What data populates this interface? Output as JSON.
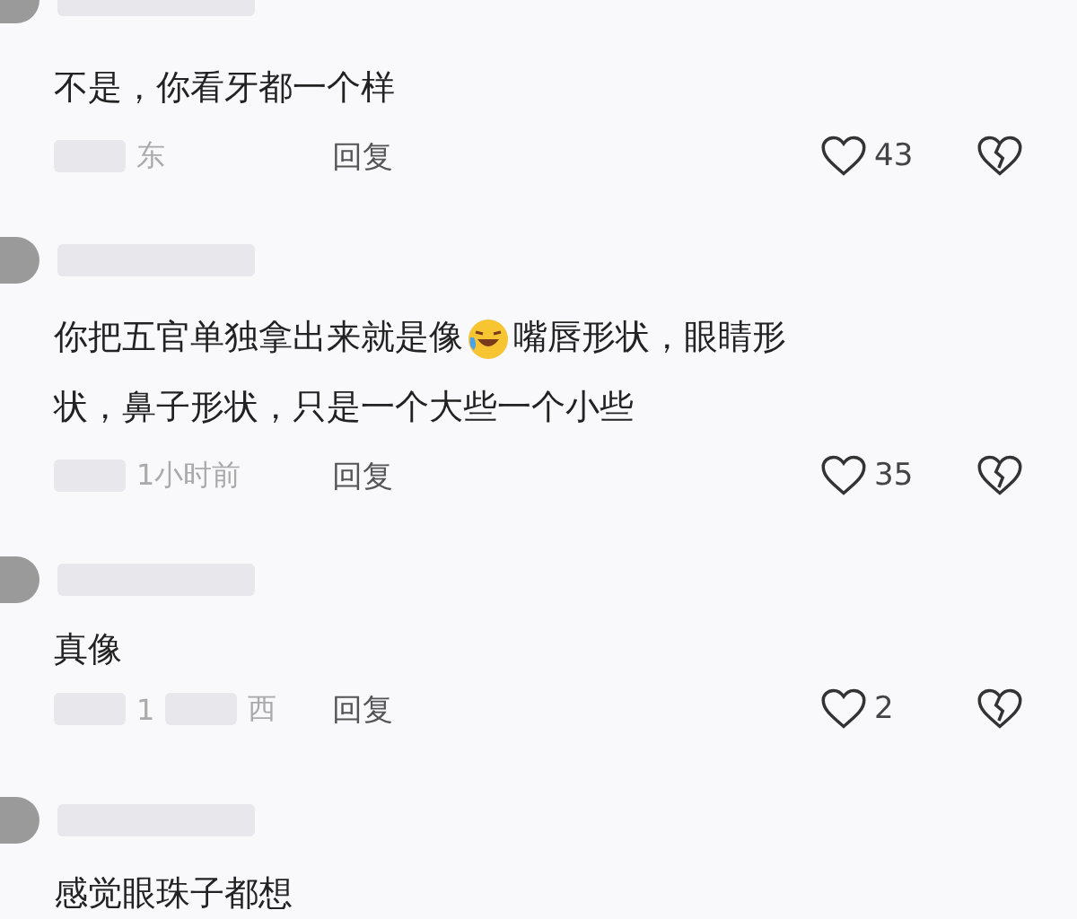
{
  "comments": [
    {
      "body": [
        [
          "不是，你看牙都一个样"
        ]
      ],
      "meta": [
        "东"
      ],
      "reply": "回复",
      "likes": "43"
    },
    {
      "body": [
        [
          "你把五官单独拿出来就是像",
          "嘴唇形状，眼睛形"
        ],
        [
          "状，鼻子形状，只是一个大些一个小些"
        ]
      ],
      "meta": [
        "1小时前"
      ],
      "reply": "回复",
      "likes": "35"
    },
    {
      "body": [
        [
          "真像"
        ]
      ],
      "meta": [
        "1",
        "西"
      ],
      "reply": "回复",
      "likes": "2"
    },
    {
      "body": [
        [
          "感觉眼珠子都想"
        ]
      ]
    }
  ]
}
